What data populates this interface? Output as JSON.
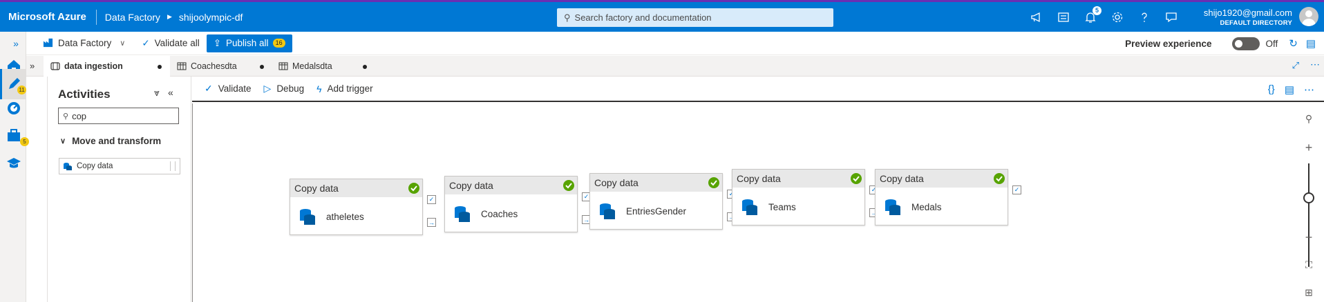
{
  "header": {
    "brand": "Microsoft Azure",
    "service": "Data Factory",
    "factory": "shijoolympic-df",
    "search_placeholder": "Search factory and documentation",
    "notifications_count": "5",
    "user_email": "shijo1920@gmail.com",
    "user_directory": "DEFAULT DIRECTORY"
  },
  "rail": {
    "author_badge": "11",
    "manage_badge": "5"
  },
  "commandbar": {
    "data_factory": "Data Factory",
    "validate_all": "Validate all",
    "publish_all": "Publish all",
    "publish_count": "16",
    "preview_label": "Preview experience",
    "toggle_state": "Off"
  },
  "tabs": [
    {
      "label": "data ingestion"
    },
    {
      "label": "Coachesdta"
    },
    {
      "label": "Medalsdta"
    }
  ],
  "activities": {
    "title": "Activities",
    "filter_value": "cop",
    "group": "Move and transform",
    "item": "Copy data"
  },
  "canvas_toolbar": {
    "validate": "Validate",
    "debug": "Debug",
    "add_trigger": "Add trigger"
  },
  "pipeline": {
    "nodes": [
      {
        "type": "Copy data",
        "name": "atheletes"
      },
      {
        "type": "Copy data",
        "name": "Coaches"
      },
      {
        "type": "Copy data",
        "name": "EntriesGender"
      },
      {
        "type": "Copy data",
        "name": "Teams"
      },
      {
        "type": "Copy data",
        "name": "Medals"
      }
    ]
  },
  "colors": {
    "azure_blue": "#0078d4",
    "success_green": "#57a300",
    "badge_yellow": "#f2c811"
  }
}
